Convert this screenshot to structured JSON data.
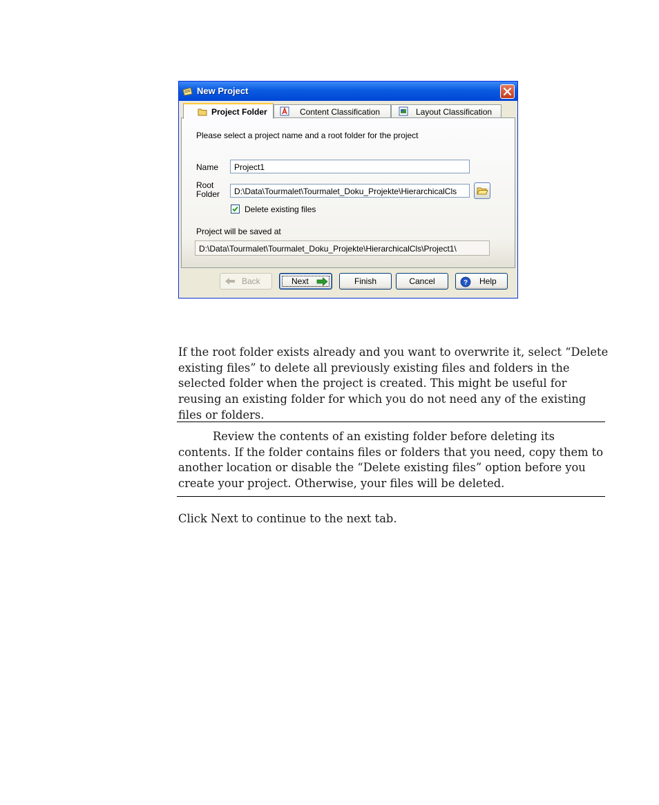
{
  "dialog": {
    "title": "New Project",
    "tabs": [
      {
        "label": "Project Folder",
        "icon": "folder-icon",
        "active": true
      },
      {
        "label": "Content Classification",
        "icon": "content-classification-icon",
        "active": false
      },
      {
        "label": "Layout Classification",
        "icon": "layout-classification-icon",
        "active": false
      }
    ],
    "instruction": "Please select a project name and a root folder for the project",
    "name_label": "Name",
    "name_value": "Project1",
    "root_label_line1": "Root",
    "root_label_line2": "Folder",
    "root_value": "D:\\Data\\Tourmalet\\Tourmalet_Doku_Projekte\\HierarchicalCls",
    "delete_checkbox_label": "Delete existing files",
    "delete_checked": true,
    "saved_at_label": "Project will be saved at",
    "saved_at_value": "D:\\Data\\Tourmalet\\Tourmalet_Doku_Projekte\\HierarchicalCls\\Project1\\",
    "buttons": {
      "back": "Back",
      "next": "Next",
      "finish": "Finish",
      "cancel": "Cancel",
      "help": "Help"
    }
  },
  "body": {
    "paragraph1": "If the root folder exists already and you want to overwrite it, select “Delete existing files” to delete all previously existing files and folders in the selected folder when the project is created. This might be useful for reusing an existing folder for which you do not need any of the existing files or folders.",
    "note": "Review the contents of an existing folder before deleting its contents. If the folder contains files or folders that you need, copy them to another location or disable the “Delete existing files” option before you create your project. Otherwise, your files will be deleted.",
    "paragraph2": "Click Next to continue to the next tab."
  },
  "colors": {
    "titlebar": "#0a5be0",
    "dialog_bg": "#ece9d8",
    "tab_highlight": "#ffc83c",
    "next_arrow": "#2e9a2e",
    "help_icon": "#2255c4"
  }
}
